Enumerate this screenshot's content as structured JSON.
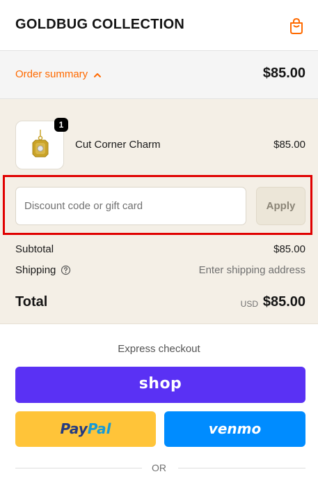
{
  "store": {
    "name": "GOLDBUG COLLECTION"
  },
  "order_summary": {
    "toggle_label": "Order summary",
    "total": "$85.00"
  },
  "cart": {
    "items": [
      {
        "name": "Cut Corner Charm",
        "price": "$85.00",
        "quantity": "1"
      }
    ]
  },
  "discount": {
    "placeholder": "Discount code or gift card",
    "value": "",
    "apply_label": "Apply"
  },
  "totals": {
    "subtotal_label": "Subtotal",
    "subtotal_value": "$85.00",
    "shipping_label": "Shipping",
    "shipping_value": "Enter shipping address",
    "total_label": "Total",
    "currency": "USD",
    "total_value": "$85.00"
  },
  "express": {
    "title": "Express checkout",
    "shop_label": "shop",
    "paypal_label_a": "Pay",
    "paypal_label_b": "Pal",
    "venmo_label": "venmo",
    "or_label": "OR"
  },
  "colors": {
    "accent": "#ff6a00",
    "summary_bg": "#f4efe6",
    "shop": "#5a31f4",
    "paypal": "#ffc439",
    "venmo": "#008cff",
    "highlight": "#e00000"
  },
  "icons": [
    "shopping-bag-icon",
    "chevron-up-icon",
    "help-circle-icon",
    "charm-pendant-image"
  ]
}
